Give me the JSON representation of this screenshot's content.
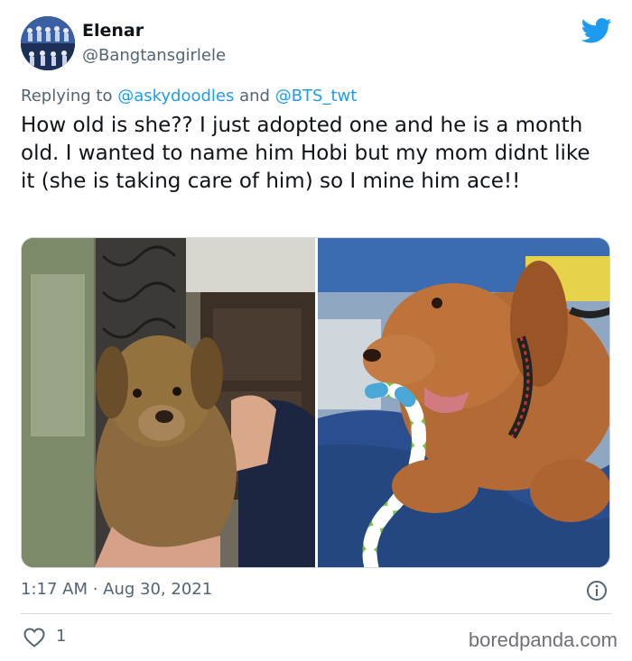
{
  "author": {
    "name": "Elenar",
    "handle": "@Bangtansgirlele"
  },
  "reply": {
    "prefix": "Replying to ",
    "mention1": "@askydoodles",
    "joiner": " and ",
    "mention2": "@BTS_twt"
  },
  "tweet": {
    "text": "How old is she?? I just adopted one and he is a month old. I wanted to name him Hobi but my mom didnt like it (she is taking care of him) so I mine him ace!!",
    "timestamp": "1:17 AM · Aug 30, 2021",
    "likes": "1"
  },
  "watermark": "boredpanda.com",
  "icons": {
    "brand": "twitter-bird-icon",
    "info": "info-icon",
    "like": "heart-icon"
  },
  "colors": {
    "twitter_blue": "#1d9bf0",
    "secondary_text": "#536471",
    "primary_text": "#0f1419"
  }
}
